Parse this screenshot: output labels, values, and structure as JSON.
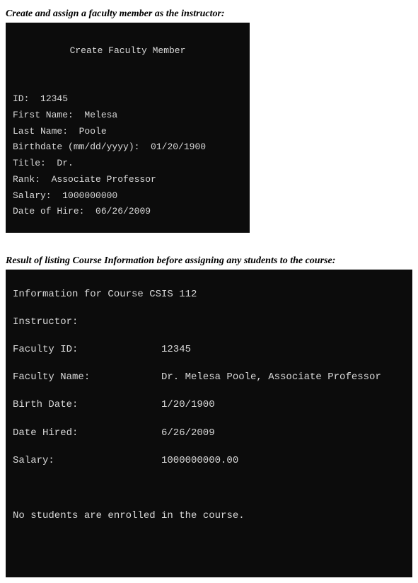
{
  "caption1": "Create and assign a faculty member as the instructor:",
  "terminal1": {
    "title": "Create Faculty Member",
    "id_label": "ID:  ",
    "id_value": "12345",
    "fname_label": "First Name:  ",
    "fname_value": "Melesa",
    "lname_label": "Last Name:  ",
    "lname_value": "Poole",
    "birth_label": "Birthdate (mm/dd/yyyy):  ",
    "birth_value": "01/20/1900",
    "title_label": "Title:  ",
    "title_value": "Dr.",
    "rank_label": "Rank:  ",
    "rank_value": "Associate Professor",
    "salary_label": "Salary:  ",
    "salary_value": "1000000000",
    "hire_label": "Date of Hire:  ",
    "hire_value": "06/26/2009"
  },
  "caption2": "Result of listing Course Information before assigning any students to the course:",
  "terminal2": {
    "header": "Information for Course CSIS 112",
    "instructor_label": "Instructor:",
    "fid_label": "Faculty ID:",
    "fid_value": "12345",
    "fname_label": "Faculty Name:",
    "fname_value": "Dr. Melesa Poole, Associate Professor",
    "birth_label": "Birth Date:",
    "birth_value": "1/20/1900",
    "hired_label": "Date Hired:",
    "hired_value": "6/26/2009",
    "salary_label": "Salary:",
    "salary_value": "1000000000.00",
    "footer": "No students are enrolled in the course."
  }
}
